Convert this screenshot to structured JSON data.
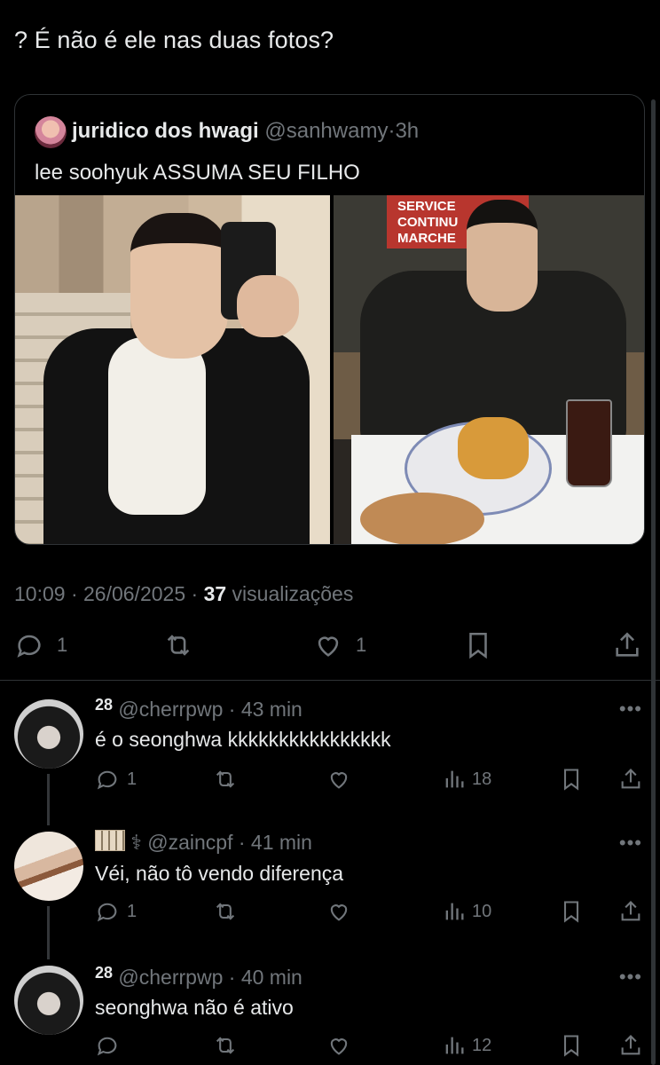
{
  "main_tweet": {
    "text": "? É não é ele nas duas fotos?",
    "timestamp": "10:09 · 26/06/2025",
    "sep": " · ",
    "views_count": "37",
    "views_label": " visualizações",
    "replies": "1",
    "likes": "1"
  },
  "quoted_tweet": {
    "name": "juridico dos hwagi",
    "handle": "@sanhwamy",
    "dot": "·",
    "time": "3h",
    "text": "lee soohyuk ASSUMA SEU FILHO",
    "awning_text": "SERVICE\nCONTINU\nMARCHE"
  },
  "replies": [
    {
      "name": "28",
      "handle": "@cherrpwp",
      "time": "· 43 min",
      "text": "é o seonghwa kkkkkkkkkkkkkkkk",
      "replies": "1",
      "views": "18",
      "more": "•••"
    },
    {
      "name": "⚕",
      "handle": "@zaincpf",
      "time": "· 41 min",
      "text": "Véi, não tô vendo diferença",
      "replies": "1",
      "views": "10",
      "more": "•••"
    },
    {
      "name": "28",
      "handle": "@cherrpwp",
      "time": "· 40 min",
      "text": "seonghwa não é ativo",
      "replies": "",
      "views": "12",
      "more": "•••"
    }
  ],
  "icons": [
    "reply-icon",
    "retweet-icon",
    "like-icon",
    "bookmark-icon",
    "share-icon",
    "views-icon",
    "more-icon"
  ],
  "colors": {
    "background": "#000000",
    "text": "#e7e9ea",
    "muted": "#71767b",
    "border": "#2f3336"
  }
}
